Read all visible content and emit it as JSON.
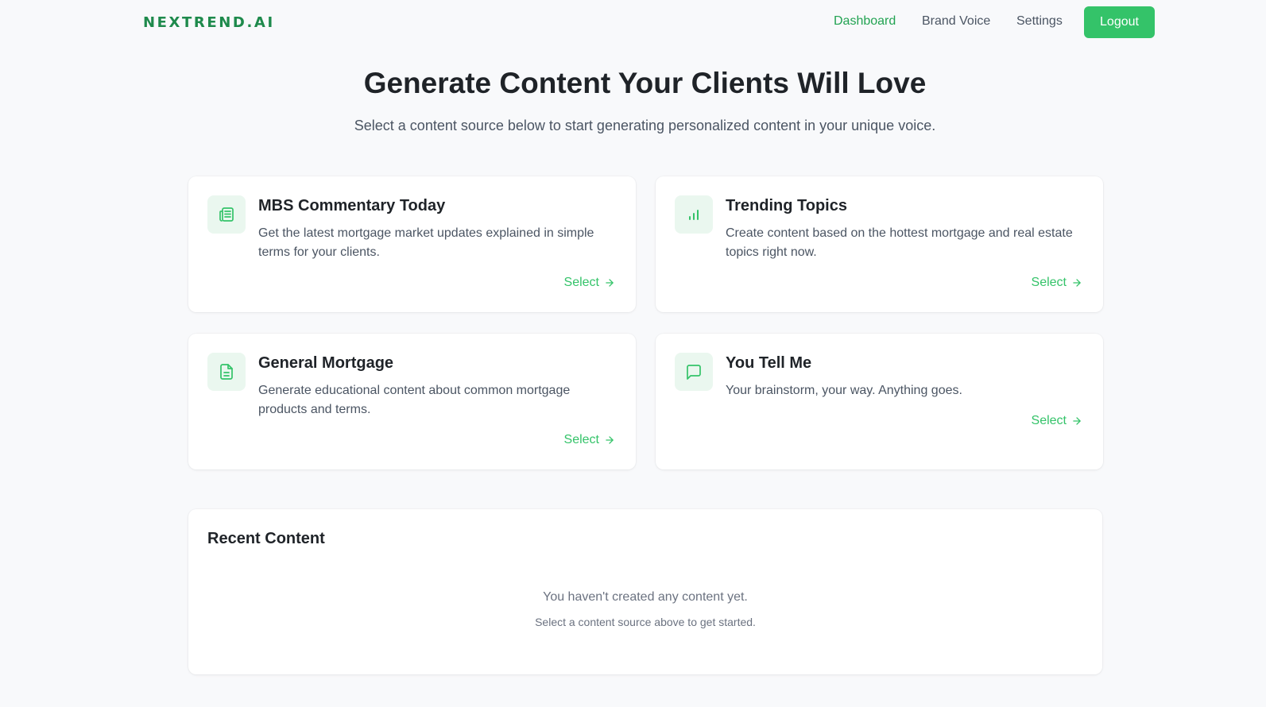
{
  "nav": {
    "logo": "NEXTREND.AI",
    "links": [
      "Dashboard",
      "Brand Voice",
      "Settings"
    ],
    "active_link": "Dashboard",
    "logout_label": "Logout"
  },
  "hero": {
    "title": "Generate Content Your Clients Will Love",
    "subtitle": "Select a content source below to start generating personalized content in your unique voice."
  },
  "cards": [
    {
      "icon": "newspaper-icon",
      "title": "MBS Commentary Today",
      "description": "Get the latest mortgage market updates explained in simple terms for your clients.",
      "select_label": "Select"
    },
    {
      "icon": "bar-chart-icon",
      "title": "Trending Topics",
      "description": "Create content based on the hottest mortgage and real estate topics right now.",
      "select_label": "Select"
    },
    {
      "icon": "document-icon",
      "title": "General Mortgage",
      "description": "Generate educational content about common mortgage products and terms.",
      "select_label": "Select"
    },
    {
      "icon": "chat-bubble-icon",
      "title": "You Tell Me",
      "description": "Your brainstorm, your way. Anything goes.",
      "select_label": "Select"
    }
  ],
  "recent": {
    "title": "Recent Content",
    "empty_message": "You haven't created any content yet.",
    "empty_hint": "Select a content source above to get started."
  },
  "colors": {
    "brand_green": "#1e8a4c",
    "accent_green": "#34c369",
    "icon_bg": "#eaf7ef",
    "page_bg": "#f8f9fb"
  }
}
